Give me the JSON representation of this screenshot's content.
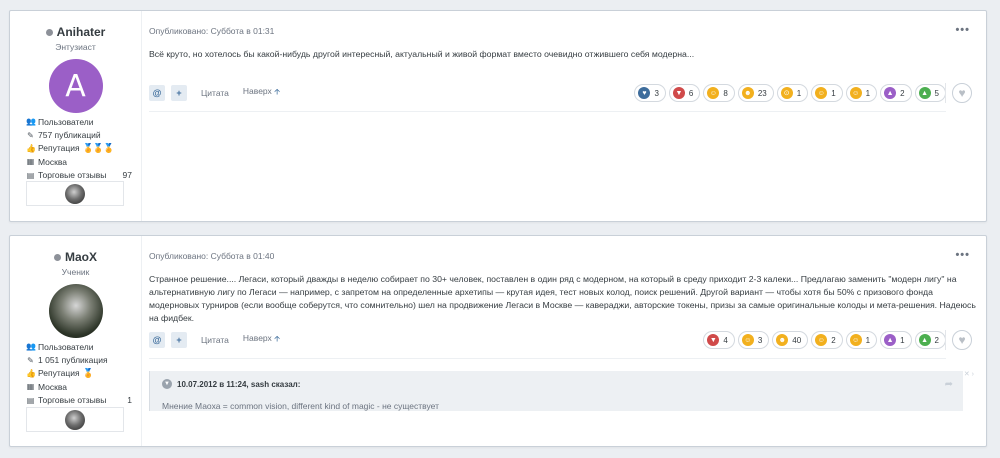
{
  "posts": [
    {
      "author": {
        "name": "Anihater",
        "title": "Энтузиаст",
        "avatar_letter": "A"
      },
      "stats": {
        "group": "Пользователи",
        "posts": "757 публикаций",
        "reputation_label": "Репутация",
        "reputation_medals": "🏅🏅🏅",
        "city": "Москва",
        "trade_label": "Торговые отзывы",
        "trade_count": "97"
      },
      "meta": "Опубликовано: Суббота в 01:31",
      "body": "Всё круто, но хотелось бы какой-нибудь другой интересный, актуальный и живой формат вместо очевидно отжившего себя модерна...",
      "actions": {
        "mention": "@",
        "plus": "+",
        "quote": "Цитата",
        "top": "Наверх"
      },
      "reactions": [
        {
          "icon": "like-icon",
          "count": "3",
          "color": "#3e6d9c"
        },
        {
          "icon": "downvote-icon",
          "count": "6",
          "color": "#d04a4a"
        },
        {
          "icon": "smirk-icon",
          "count": "8",
          "color": "#f2b01e"
        },
        {
          "icon": "facepalm-icon",
          "count": "23",
          "color": "#f2b01e"
        },
        {
          "icon": "surprised-icon",
          "count": "1",
          "color": "#f2b01e"
        },
        {
          "icon": "confused-icon",
          "count": "1",
          "color": "#f2b01e"
        },
        {
          "icon": "laugh-icon",
          "count": "1",
          "color": "#f2b01e"
        },
        {
          "icon": "thumbs-up-icon",
          "count": "2",
          "color": "#9b5fc7"
        },
        {
          "icon": "upvote-icon",
          "count": "5",
          "color": "#4caf50"
        }
      ]
    },
    {
      "author": {
        "name": "MaoX",
        "title": "Ученик"
      },
      "stats": {
        "group": "Пользователи",
        "posts": "1 051 публикация",
        "reputation_label": "Репутация",
        "reputation_medals": "🏅",
        "city": "Москва",
        "trade_label": "Торговые отзывы",
        "trade_count": "1"
      },
      "meta": "Опубликовано: Суббота в 01:40",
      "body": "Странное решение.... Легаси, который дважды в неделю собирает по 30+ человек, поставлен в один ряд с модерном, на который в среду приходит 2-3 калеки... Предлагаю заменить \"модерн лигу\" на альтернативную лигу по Легаси — например, с запретом на определенные архетипы — крутая идея, тест новых колод, поиск решений. Другой вариант — чтобы хотя бы 50% с призового фонда модерновых турниров (если вообще соберутся, что сомнительно) шел на продвижение Легаси в Москве — кавераджи, авторские токены, призы за самые оригинальные колоды и мета-решения. Надеюсь на фидбек.",
      "actions": {
        "mention": "@",
        "plus": "+",
        "quote": "Цитата",
        "top": "Наверх"
      },
      "reactions": [
        {
          "icon": "downvote-icon",
          "count": "4",
          "color": "#d04a4a"
        },
        {
          "icon": "smirk-icon",
          "count": "3",
          "color": "#f2b01e"
        },
        {
          "icon": "facepalm-icon",
          "count": "40",
          "color": "#f2b01e"
        },
        {
          "icon": "confused-icon",
          "count": "2",
          "color": "#f2b01e"
        },
        {
          "icon": "laugh-icon",
          "count": "1",
          "color": "#f2b01e"
        },
        {
          "icon": "thumbs-up-icon",
          "count": "1",
          "color": "#9b5fc7"
        },
        {
          "icon": "upvote-icon",
          "count": "2",
          "color": "#4caf50"
        }
      ],
      "quote": {
        "header": "10.07.2012 в 11:24, sash сказал:",
        "body": "Мнение Маоха = common vision, different kind of magic - не существует"
      }
    }
  ]
}
